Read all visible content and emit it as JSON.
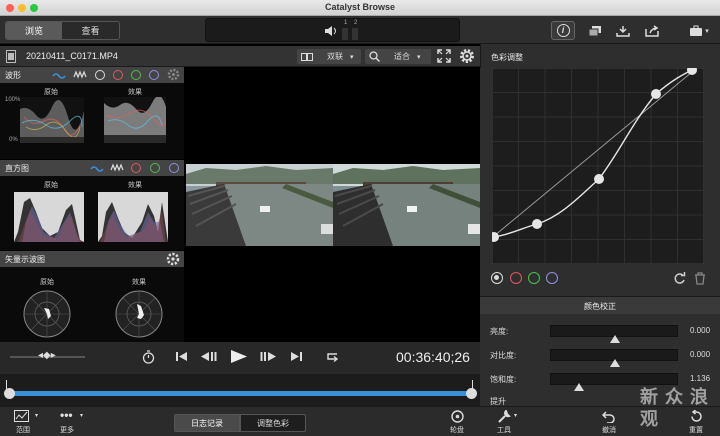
{
  "window": {
    "title": "Catalyst Browse"
  },
  "toolbar": {
    "tab_browse": "浏览",
    "tab_view": "查看",
    "lcd_ch1": "1",
    "lcd_ch2": "2"
  },
  "file": {
    "name": "20210411_C0171.MP4",
    "compare_mode": "双联",
    "zoom": "适合"
  },
  "waveform": {
    "title": "波形",
    "pct_top": "100%",
    "pct_bottom": "0%",
    "label_orig": "原始",
    "label_fx": "效果"
  },
  "histogram": {
    "title": "直方图",
    "label_orig": "原始",
    "label_fx": "效果"
  },
  "vectorscope": {
    "title": "矢量示波图",
    "label_orig": "原始",
    "label_fx": "效果"
  },
  "player": {
    "timecode": "00:36:40;26",
    "progress": 1.0
  },
  "bottom": {
    "range": "范围",
    "more": "更多",
    "tab_log": "日志记录",
    "tab_color": "调整色彩",
    "wheel": "轮盘"
  },
  "curves": {
    "title": "色彩调整",
    "channel_colors": [
      "#dddddd",
      "#e05a5a",
      "#4fbf4f",
      "#8f8fe8"
    ]
  },
  "color_correction": {
    "title": "颜色校正",
    "rows": [
      {
        "label": "亮度:",
        "value": "0.000",
        "level": 0.5
      },
      {
        "label": "对比度:",
        "value": "0.000",
        "level": 0.5
      },
      {
        "label": "饱和度:",
        "value": "1.136",
        "level": 0.22
      }
    ],
    "lift": "提升"
  },
  "footer": {
    "tools": "工具",
    "undo": "撤消",
    "reset": "重置"
  },
  "watermark": "新 众 浪 观",
  "colors": {
    "accent": "#3a8fd8",
    "panel": "#2e2e2e",
    "header": "#444444"
  }
}
